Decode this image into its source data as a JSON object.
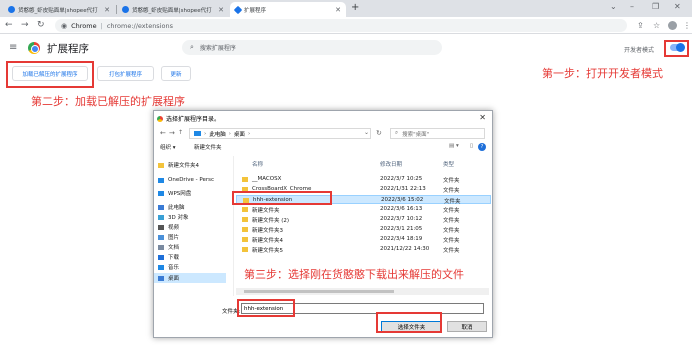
{
  "browser": {
    "tabs": [
      {
        "label": "货憨憨_虾皮贴面单|shopee代打",
        "active": false,
        "icon_color": "#1a73e8"
      },
      {
        "label": "货憨憨_虾皮贴面单|shopee代打",
        "active": false,
        "icon_color": "#1a73e8"
      },
      {
        "label": "扩展程序",
        "active": true,
        "icon_color": "#1a73e8"
      }
    ],
    "new_tab_symbol": "+",
    "address": {
      "site_label": "Chrome",
      "separator": "|",
      "path": "chrome://extensions"
    }
  },
  "extensions_page": {
    "title": "扩展程序",
    "search_placeholder": "搜索扩展程序",
    "developer_mode_label": "开发者模式",
    "developer_mode_on": true,
    "buttons": [
      "加载已解压的扩展程序",
      "打包扩展程序",
      "更新"
    ]
  },
  "annotations": {
    "step1": "第一步：打开开发者模式",
    "step2": "第二步：加载已解压的扩展程序",
    "step3": "第三步：选择刚在货憨憨下载出来解压的文件"
  },
  "dialog": {
    "title": "选择扩展程序目录。",
    "path": [
      "此电脑",
      "桌面"
    ],
    "search_placeholder": "搜索\"桌面\"",
    "toolbar": {
      "organize": "组织 ▾",
      "new_folder": "新建文件夹"
    },
    "nav_items": [
      {
        "label": "新建文件夹4",
        "color": "#f3c33b",
        "selected": false
      },
      {
        "label": "OneDrive - Persc",
        "color": "#1e88e5",
        "selected": false
      },
      {
        "label": "WPS网盘",
        "color": "#1e88e5",
        "selected": false
      },
      {
        "label": "此电脑",
        "color": "#3a7bd5",
        "selected": false
      },
      {
        "label": "3D 对象",
        "color": "#3aa0d5",
        "selected": false
      },
      {
        "label": "视频",
        "color": "#555555",
        "selected": false
      },
      {
        "label": "图片",
        "color": "#4a90d9",
        "selected": false
      },
      {
        "label": "文档",
        "color": "#7a8aa0",
        "selected": false
      },
      {
        "label": "下载",
        "color": "#1e6fd9",
        "selected": false
      },
      {
        "label": "音乐",
        "color": "#1e88e5",
        "selected": false
      },
      {
        "label": "桌面",
        "color": "#3a7bd5",
        "selected": true
      }
    ],
    "columns": {
      "name": "名称",
      "date": "修改日期",
      "type": "类型"
    },
    "files": [
      {
        "name": "__MACOSX",
        "date": "2022/3/7 10:25",
        "type": "文件夹",
        "selected": false
      },
      {
        "name": "CrossBoardX_Chrome",
        "date": "2022/1/31 22:13",
        "type": "文件夹",
        "selected": false
      },
      {
        "name": "hhh-extension",
        "date": "2022/3/6 15:02",
        "type": "文件夹",
        "selected": true
      },
      {
        "name": "新建文件夹",
        "date": "2022/3/6 16:13",
        "type": "文件夹",
        "selected": false
      },
      {
        "name": "新建文件夹 (2)",
        "date": "2022/3/7 10:12",
        "type": "文件夹",
        "selected": false
      },
      {
        "name": "新建文件夹3",
        "date": "2022/3/1 21:05",
        "type": "文件夹",
        "selected": false
      },
      {
        "name": "新建文件夹4",
        "date": "2022/3/4 18:19",
        "type": "文件夹",
        "selected": false
      },
      {
        "name": "新建文件夹5",
        "date": "2021/12/22 14:30",
        "type": "文件夹",
        "selected": false
      }
    ],
    "filename_label": "文件夹:",
    "filename_value": "hhh-extension",
    "select_button": "选择文件夹",
    "cancel_button": "取消"
  }
}
